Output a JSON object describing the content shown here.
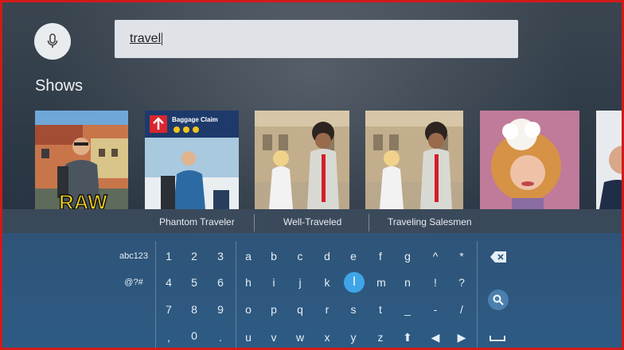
{
  "search": {
    "mic_icon": "microphone-icon",
    "query": "travel"
  },
  "section": {
    "title": "Shows"
  },
  "shows": [
    {
      "id": "raw",
      "overlay_text": "RAW"
    },
    {
      "id": "baggage",
      "sign_text": "Baggage Claim"
    },
    {
      "id": "street-1"
    },
    {
      "id": "street-2"
    },
    {
      "id": "portrait"
    },
    {
      "id": "partial"
    }
  ],
  "labels": [
    "Phantom Traveler",
    "Well-Traveled",
    "Traveling Salesmen"
  ],
  "keyboard": {
    "left_keys": [
      "abc123",
      "@?#"
    ],
    "rows": [
      [
        "1",
        "2",
        "3",
        "a",
        "b",
        "c",
        "d",
        "e",
        "f",
        "g",
        "^",
        "*"
      ],
      [
        "4",
        "5",
        "6",
        "h",
        "i",
        "j",
        "k",
        "l",
        "m",
        "n",
        "!",
        "?"
      ],
      [
        "7",
        "8",
        "9",
        "o",
        "p",
        "q",
        "r",
        "s",
        "t",
        "_",
        "-",
        "/"
      ],
      [
        ",",
        "0",
        ".",
        "u",
        "v",
        "w",
        "x",
        "y",
        "z",
        "⬆",
        "◀",
        "▶"
      ]
    ],
    "selected_key": "l",
    "side_icons": [
      "backspace-icon",
      "search-icon",
      "space-icon"
    ],
    "colors": {
      "selected": "#3fa5e8",
      "background": "#2d5b84"
    }
  }
}
